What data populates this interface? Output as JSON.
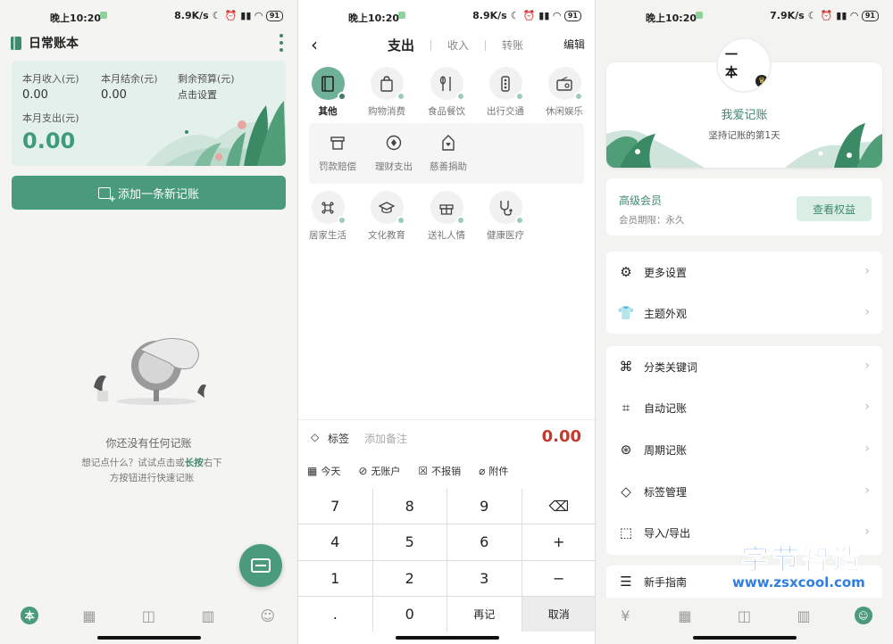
{
  "status_bars": [
    {
      "time": "晚上10:20",
      "speed": "8.9K/s",
      "battery": "91"
    },
    {
      "time": "晚上10:20",
      "speed": "8.9K/s",
      "battery": "91"
    },
    {
      "time": "晚上10:20",
      "speed": "7.9K/s",
      "battery": "91"
    }
  ],
  "home": {
    "title": "日常账本",
    "summary": {
      "income_label": "本月收入(元)",
      "income_value": "0.00",
      "balance_label": "本月结余(元)",
      "balance_value": "0.00",
      "budget_label": "剩余预算(元)",
      "budget_value": "点击设置",
      "expense_label": "本月支出(元)",
      "expense_value": "0.00"
    },
    "add_button": "添加一条新记账",
    "empty_title": "你还没有任何记账",
    "empty_hint_pre": "想记点什么？试试点击或",
    "empty_hint_bold": "长按",
    "empty_hint_post": "右下方按钮进行快速记账"
  },
  "record": {
    "tabs": [
      "支出",
      "收入",
      "转账"
    ],
    "edit": "编辑",
    "categories_row1": [
      {
        "label": "其他",
        "icon": "notebook-icon",
        "selected": true
      },
      {
        "label": "购物消费",
        "icon": "shopping-bag-icon",
        "selected": false
      },
      {
        "label": "食品餐饮",
        "icon": "fork-knife-icon",
        "selected": false
      },
      {
        "label": "出行交通",
        "icon": "traffic-light-icon",
        "selected": false
      },
      {
        "label": "休闲娱乐",
        "icon": "radio-icon",
        "selected": false
      }
    ],
    "subcategories": [
      {
        "label": "罚款赔偿",
        "icon": "monitor-icon"
      },
      {
        "label": "理财支出",
        "icon": "diamond-icon"
      },
      {
        "label": "慈善捐助",
        "icon": "donation-icon"
      }
    ],
    "categories_row2": [
      {
        "label": "居家生活",
        "icon": "command-icon"
      },
      {
        "label": "文化教育",
        "icon": "graduation-cap-icon"
      },
      {
        "label": "送礼人情",
        "icon": "gift-icon"
      },
      {
        "label": "健康医疗",
        "icon": "stethoscope-icon"
      }
    ],
    "tag_label": "标签",
    "note_placeholder": "添加备注",
    "amount": "0.00",
    "options": [
      "今天",
      "无账户",
      "不报销",
      "附件"
    ],
    "keys": [
      "7",
      "8",
      "9",
      "⌫",
      "4",
      "5",
      "6",
      "+",
      "1",
      "2",
      "3",
      "−",
      ".",
      "0",
      "再记",
      "取消"
    ]
  },
  "profile": {
    "avatar_text": "一本",
    "nickname": "我爱记账",
    "days": "坚持记账的第1天",
    "vip_title": "高级会员",
    "vip_expiry": "会员期限：永久",
    "vip_button": "查看权益",
    "menu_group1": [
      {
        "label": "更多设置",
        "icon": "gear-icon"
      },
      {
        "label": "主题外观",
        "icon": "tshirt-icon"
      }
    ],
    "menu_group2": [
      {
        "label": "分类关键词",
        "icon": "grid-icon"
      },
      {
        "label": "自动记账",
        "icon": "crop-icon"
      },
      {
        "label": "周期记账",
        "icon": "cycle-icon"
      },
      {
        "label": "标签管理",
        "icon": "tag-icon"
      },
      {
        "label": "导入/导出",
        "icon": "import-export-icon"
      }
    ],
    "menu_group3": [
      {
        "label": "新手指南",
        "icon": "guide-icon"
      }
    ]
  },
  "watermark": {
    "title": "字节智造",
    "url": "www.zsxcool.com"
  },
  "colors": {
    "accent": "#4a9a7c",
    "amount_red": "#c23b2e",
    "mint_bg": "#e4f0ec"
  }
}
